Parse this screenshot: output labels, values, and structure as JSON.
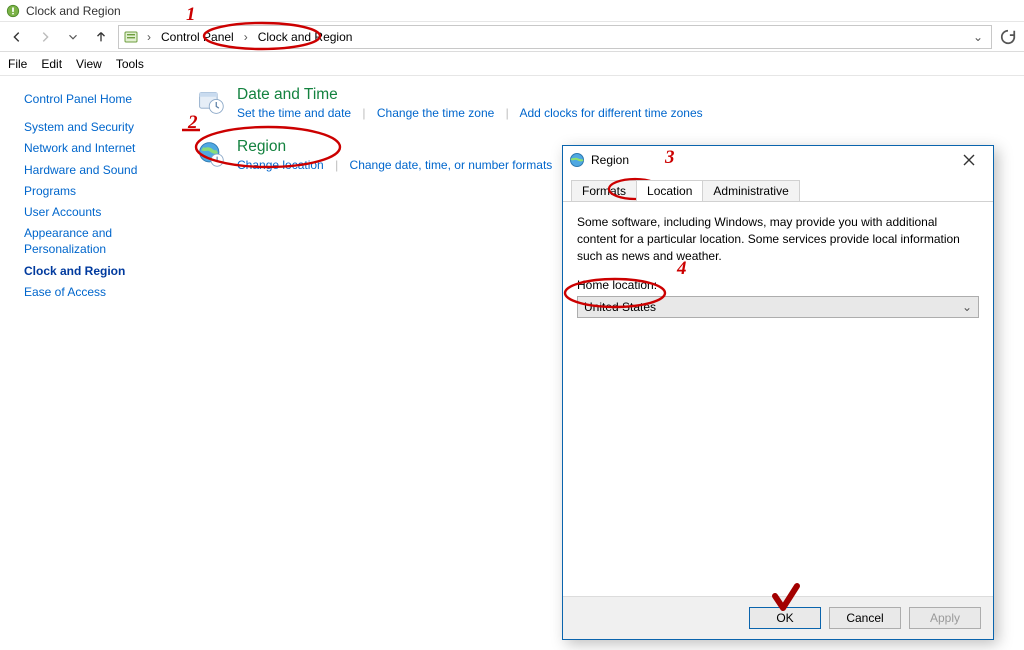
{
  "window": {
    "title": "Clock and Region"
  },
  "breadcrumb": {
    "root": "Control Panel",
    "current": "Clock and Region"
  },
  "menu": {
    "file": "File",
    "edit": "Edit",
    "view": "View",
    "tools": "Tools"
  },
  "sidebar": {
    "items": [
      "Control Panel Home",
      "System and Security",
      "Network and Internet",
      "Hardware and Sound",
      "Programs",
      "User Accounts",
      "Appearance and Personalization",
      "Clock and Region",
      "Ease of Access"
    ],
    "current_index": 7
  },
  "categories": {
    "datetime": {
      "title": "Date and Time",
      "links": [
        "Set the time and date",
        "Change the time zone",
        "Add clocks for different time zones"
      ]
    },
    "region": {
      "title": "Region",
      "links": [
        "Change location",
        "Change date, time, or number formats"
      ]
    }
  },
  "dialog": {
    "title": "Region",
    "tabs": {
      "formats": "Formats",
      "location": "Location",
      "admin": "Administrative"
    },
    "active_tab": "location",
    "description": "Some software, including Windows, may provide you with additional content for a particular location. Some services provide local information such as news and weather.",
    "home_label": "Home location:",
    "home_value": "United States",
    "buttons": {
      "ok": "OK",
      "cancel": "Cancel",
      "apply": "Apply"
    }
  },
  "annotations": {
    "n1": "1",
    "n2": "2",
    "n3": "3",
    "n4": "4"
  }
}
